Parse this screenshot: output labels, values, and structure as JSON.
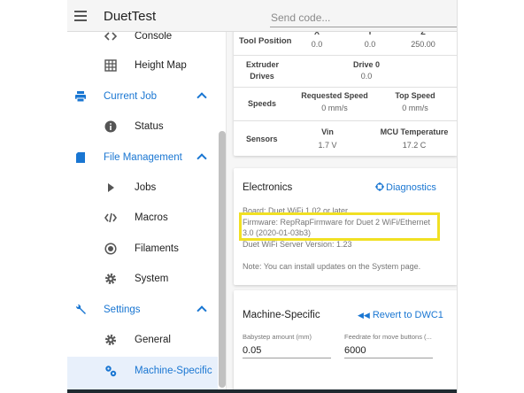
{
  "toolbar": {
    "title": "DuetTest",
    "send_placeholder": "Send code..."
  },
  "sidebar": {
    "items": [
      {
        "label": "Console",
        "icon": "code-icon"
      },
      {
        "label": "Height Map",
        "icon": "grid-icon"
      },
      {
        "label": "Current Job",
        "icon": "printer-icon",
        "group": true
      },
      {
        "label": "Status",
        "icon": "info-icon"
      },
      {
        "label": "File Management",
        "icon": "sd-card-icon",
        "group": true
      },
      {
        "label": "Jobs",
        "icon": "play-icon"
      },
      {
        "label": "Macros",
        "icon": "code-braces-icon"
      },
      {
        "label": "Filaments",
        "icon": "radiobox-icon"
      },
      {
        "label": "System",
        "icon": "gear-icon"
      },
      {
        "label": "Settings",
        "icon": "wrench-icon",
        "group": true
      },
      {
        "label": "General",
        "icon": "gear-icon"
      },
      {
        "label": "Machine-Specific",
        "icon": "gears-icon",
        "active": true
      }
    ]
  },
  "status": {
    "tool_position": {
      "label": "Tool Position",
      "axes": [
        "X",
        "Y",
        "Z"
      ],
      "values": [
        "0.0",
        "0.0",
        "250.00"
      ]
    },
    "extruder": {
      "label_line1": "Extruder",
      "label_line2": "Drives",
      "drive_label": "Drive 0",
      "drive_value": "0.0"
    },
    "speeds": {
      "label": "Speeds",
      "requested_label": "Requested Speed",
      "requested_value": "0 mm/s",
      "top_label": "Top Speed",
      "top_value": "0 mm/s"
    },
    "sensors": {
      "label": "Sensors",
      "vin_label": "Vin",
      "vin_value": "1.7 V",
      "mcu_label": "MCU Temperature",
      "mcu_value": "17.2 C"
    }
  },
  "electronics": {
    "title": "Electronics",
    "diagnostics_label": "Diagnostics",
    "board": "Board: Duet WiFi 1.02 or later",
    "firmware_line1": "Firmware: RepRapFirmware for Duet 2 WiFi/Ethernet",
    "firmware_line2": "3.0 (2020-01-03b3)",
    "wifi_server": "Duet WiFi Server Version: 1.23",
    "note": "Note: You can install updates on the System page.",
    "highlight_color": "#f1e023"
  },
  "machine_specific": {
    "title": "Machine-Specific",
    "revert_label": "Revert to DWC1",
    "babystep_label": "Babystep amount (mm)",
    "babystep_value": "0.05",
    "feedrate_label": "Feedrate for move buttons (...",
    "feedrate_value": "6000"
  },
  "colors": {
    "accent": "#1976d2",
    "active_bg": "#e8f0fb"
  }
}
